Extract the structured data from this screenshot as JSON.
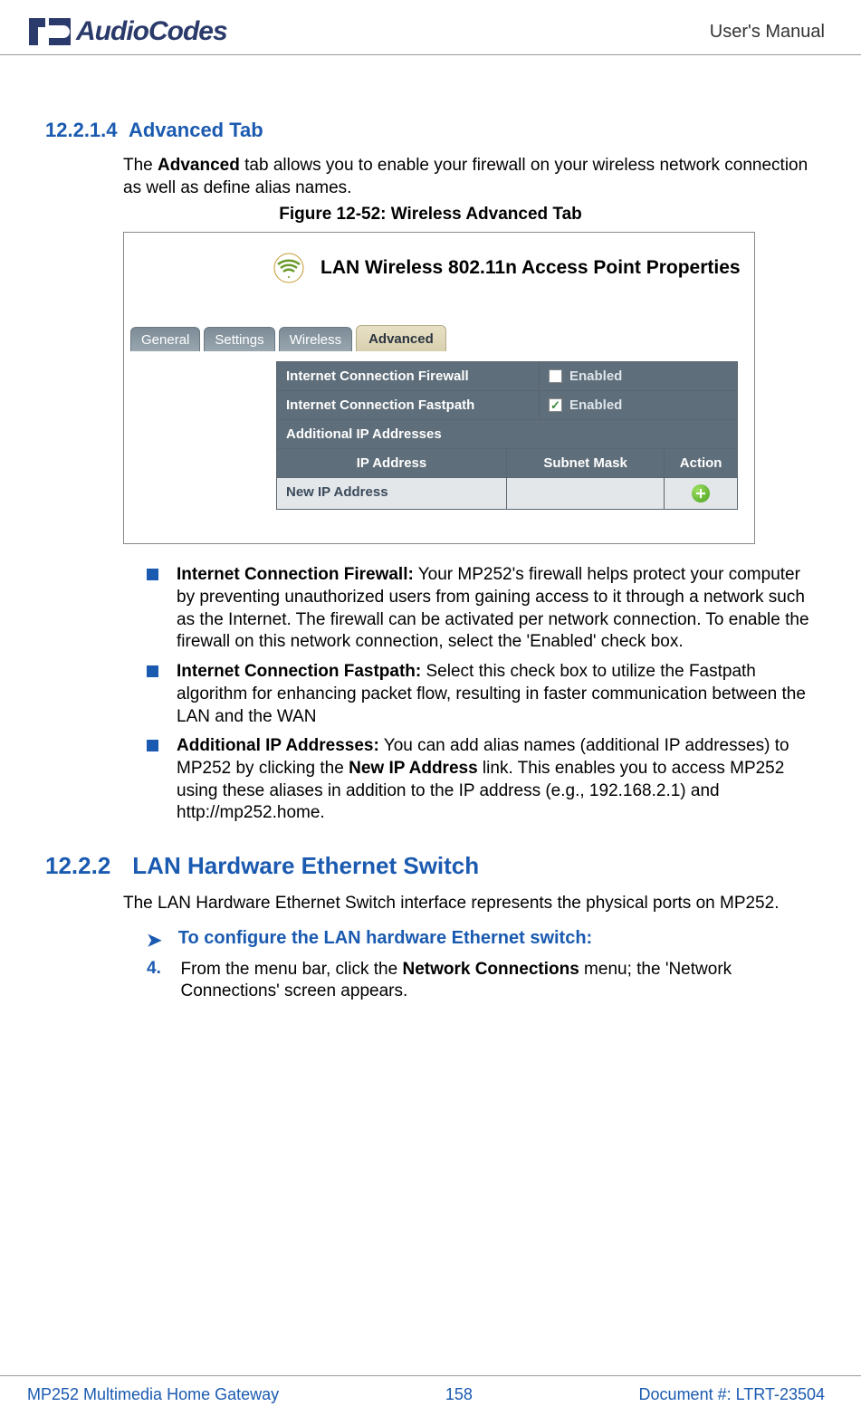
{
  "header": {
    "logo_text": "AudioCodes",
    "right": "User's Manual"
  },
  "section_h4": {
    "num": "12.2.1.4",
    "title": "Advanced Tab"
  },
  "intro_para": {
    "prefix": "The ",
    "bold": "Advanced",
    "suffix": " tab allows you to enable your firewall on your wireless network connection as well as define alias names."
  },
  "figure_caption": "Figure 12-52: Wireless Advanced Tab",
  "figure": {
    "title": "LAN Wireless 802.11n Access Point Properties",
    "tabs": [
      "General",
      "Settings",
      "Wireless",
      "Advanced"
    ],
    "active_tab_index": 3,
    "rows": {
      "firewall_label": "Internet Connection Firewall",
      "firewall_val": "Enabled",
      "firewall_checked": false,
      "fastpath_label": "Internet Connection Fastpath",
      "fastpath_val": "Enabled",
      "fastpath_checked": true,
      "additional_label": "Additional IP Addresses",
      "col_ip": "IP Address",
      "col_mask": "Subnet Mask",
      "col_action": "Action",
      "new_ip": "New IP Address"
    }
  },
  "bullets": [
    {
      "bold": "Internet Connection Firewall:",
      "text": " Your MP252's firewall helps protect your computer by preventing unauthorized users from gaining access to it through a network such as the Internet. The firewall can be activated per network connection. To enable the firewall on this network connection, select the 'Enabled' check box."
    },
    {
      "bold": "Internet Connection Fastpath:",
      "text": " Select this check box to utilize the Fastpath algorithm for enhancing packet flow, resulting in faster communication between the LAN and the WAN"
    },
    {
      "bold": "Additional IP Addresses:",
      "text_before": " You can add alias names (additional IP addresses) to MP252 by clicking the ",
      "bold2": "New IP Address",
      "text_after": " link. This enables you to access MP252 using these aliases in addition to the IP address (e.g., 192.168.2.1) and http://mp252.home."
    }
  ],
  "section_h3": {
    "num": "12.2.2",
    "title": "LAN Hardware Ethernet Switch"
  },
  "h3_para": "The LAN Hardware Ethernet Switch interface represents the physical ports on MP252.",
  "procedure": "To configure the LAN hardware Ethernet switch:",
  "step": {
    "num": "4.",
    "before": "From the menu bar, click the ",
    "bold": "Network Connections",
    "after": " menu; the 'Network Connections' screen appears."
  },
  "footer": {
    "left": "MP252 Multimedia Home Gateway",
    "center": "158",
    "right": "Document #: LTRT-23504"
  }
}
